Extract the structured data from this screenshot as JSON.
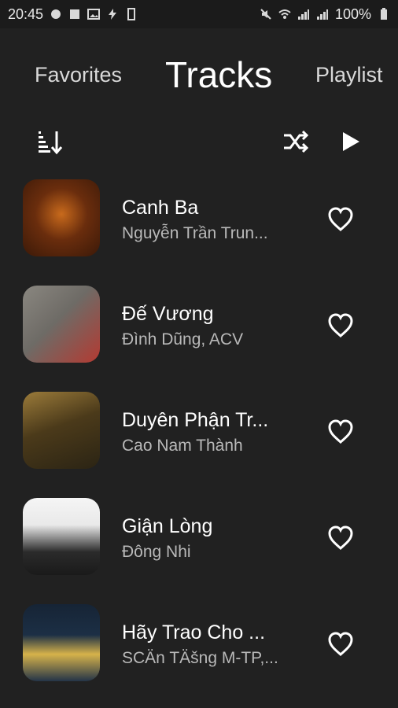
{
  "status": {
    "time": "20:45",
    "battery": "100%"
  },
  "tabs": {
    "favorites": "Favorites",
    "tracks": "Tracks",
    "playlist": "Playlist"
  },
  "toolbar": {
    "sort_icon": "sort-icon",
    "shuffle_icon": "shuffle-icon",
    "play_icon": "play-icon"
  },
  "tracks": [
    {
      "title": "Canh Ba",
      "artist": "Nguyễn Trần Trun...",
      "art_colors": [
        "#3b1908",
        "#c86a1c"
      ]
    },
    {
      "title": "Đế Vương",
      "artist": "Đình Dũng, ACV",
      "art_colors": [
        "#6e6b66",
        "#b43a32"
      ]
    },
    {
      "title": "Duyên Phận Tr...",
      "artist": "Cao Nam Thành",
      "art_colors": [
        "#2b2414",
        "#9b7b3a"
      ]
    },
    {
      "title": "Giận Lòng",
      "artist": "Đông Nhi",
      "art_colors": [
        "#f5f5f5",
        "#2b2b2b"
      ]
    },
    {
      "title": "Hãy Trao Cho ...",
      "artist": "SCÄn TÄšng M-TP,...",
      "art_colors": [
        "#162435",
        "#d6b24a"
      ]
    }
  ]
}
